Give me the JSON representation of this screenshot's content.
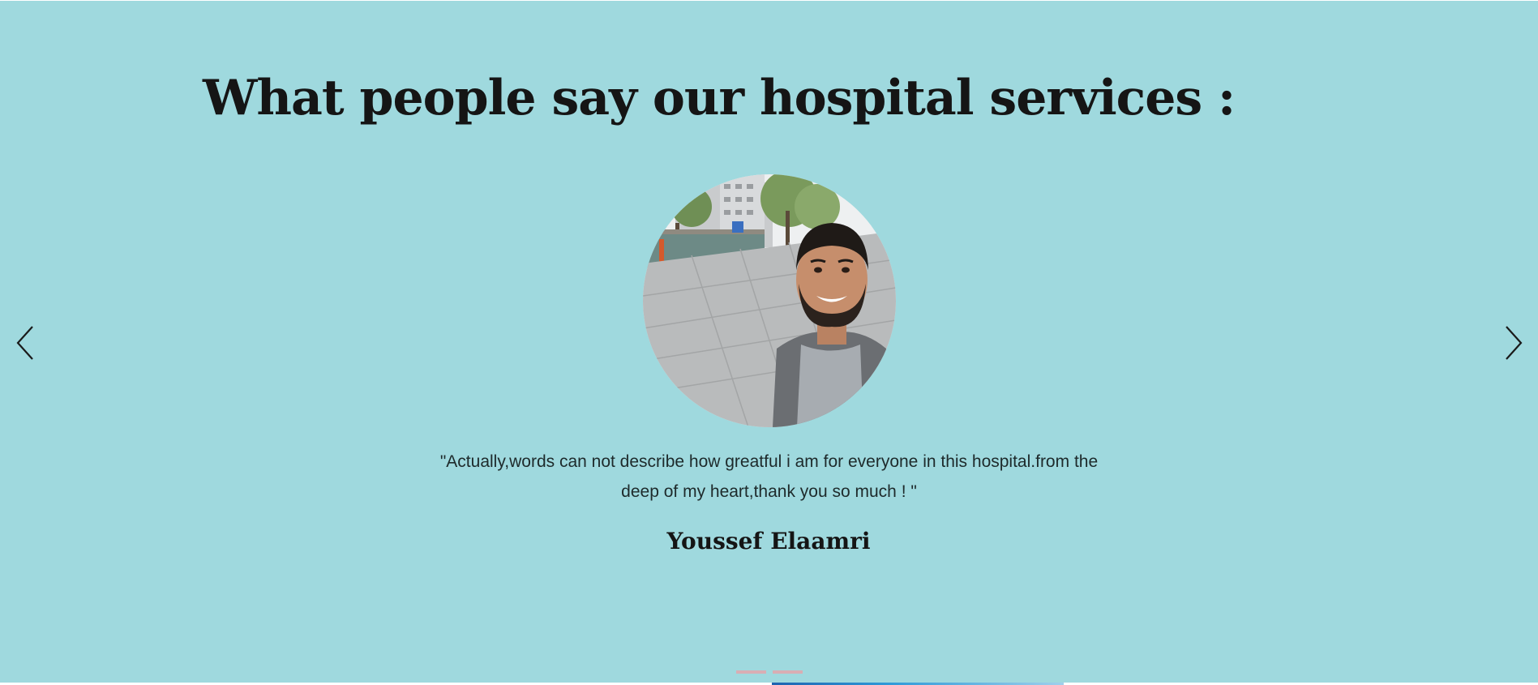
{
  "section": {
    "heading": "What people say our hospital services :",
    "background_color": "#9fd9de"
  },
  "carousel": {
    "prev_icon": "chevron-left-icon",
    "next_icon": "chevron-right-icon",
    "active_slide": {
      "photo": "portrait-photo",
      "quote": "\"Actually,words can not describe how greatful i am for everyone in this hospital.from the deep of my heart,thank you so much ! \"",
      "name": "Youssef Elaamri"
    },
    "indicator_count": 2,
    "indicator_color": "#d8aeb4"
  }
}
